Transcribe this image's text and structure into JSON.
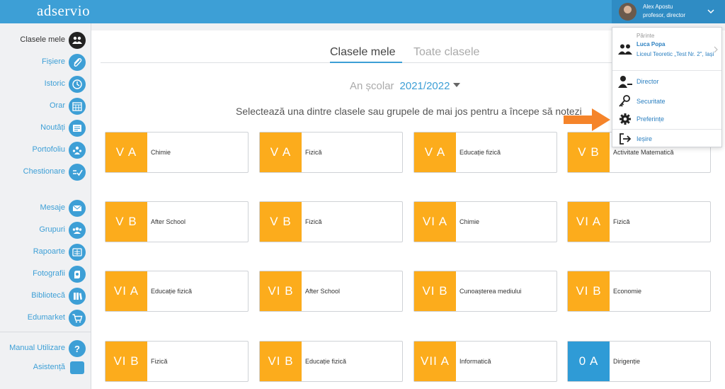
{
  "app": {
    "logo_text": "adservio"
  },
  "user": {
    "name": "Alex Apostu",
    "role": "profesor, director"
  },
  "sidebar": {
    "items": [
      {
        "label": "Clasele mele",
        "icon": "class-icon"
      },
      {
        "label": "Fișiere",
        "icon": "paperclip-icon"
      },
      {
        "label": "Istoric",
        "icon": "history-icon"
      },
      {
        "label": "Orar",
        "icon": "calendar-icon"
      },
      {
        "label": "Noutăți",
        "icon": "news-icon"
      },
      {
        "label": "Portofoliu",
        "icon": "portfolio-icon"
      },
      {
        "label": "Chestionare",
        "icon": "checklist-icon"
      },
      {
        "label": "Mesaje",
        "icon": "envelope-icon"
      },
      {
        "label": "Grupuri",
        "icon": "group-icon"
      },
      {
        "label": "Rapoarte",
        "icon": "report-icon"
      },
      {
        "label": "Fotografii",
        "icon": "photo-icon"
      },
      {
        "label": "Bibliotecă",
        "icon": "library-icon"
      },
      {
        "label": "Edumarket",
        "icon": "cart-icon"
      },
      {
        "label": "Manual Utilizare",
        "icon": "help-icon"
      },
      {
        "label": "Asistență",
        "icon": "chat-icon"
      }
    ]
  },
  "main": {
    "tabs": [
      {
        "label": "Clasele mele"
      },
      {
        "label": "Toate clasele"
      }
    ],
    "school_year": {
      "label": "An școlar",
      "value": "2021/2022"
    },
    "instruction": "Selectează una dintre clasele sau grupele de mai jos pentru a începe să notezi"
  },
  "classes": [
    {
      "class": "V A",
      "subject": "Chimie"
    },
    {
      "class": "V A",
      "subject": "Fizică"
    },
    {
      "class": "V A",
      "subject": "Educație fizică"
    },
    {
      "class": "V B",
      "subject": "Activitate Matematică"
    },
    {
      "class": "V B",
      "subject": "After School"
    },
    {
      "class": "V B",
      "subject": "Fizică"
    },
    {
      "class": "VI A",
      "subject": "Chimie"
    },
    {
      "class": "VI A",
      "subject": "Fizică"
    },
    {
      "class": "VI A",
      "subject": "Educație fizică"
    },
    {
      "class": "VI B",
      "subject": "After School"
    },
    {
      "class": "VI B",
      "subject": "Cunoașterea mediului"
    },
    {
      "class": "VI B",
      "subject": "Economie"
    },
    {
      "class": "VI B",
      "subject": "Fizică"
    },
    {
      "class": "VI B",
      "subject": "Educație fizică"
    },
    {
      "class": "VII A",
      "subject": "Informatică"
    },
    {
      "class": "0 A",
      "subject": "Dirigenție"
    }
  ],
  "dropdown": {
    "parent_label": "Părinte",
    "parent_name": "Luca Popa",
    "parent_school": "Liceul Teoretic „Test Nr. 2\", Iași",
    "items": [
      {
        "label": "Director",
        "icon": "director-icon"
      },
      {
        "label": "Securitate",
        "icon": "key-icon"
      },
      {
        "label": "Preferințe",
        "icon": "gear-icon"
      },
      {
        "label": "Ieșire",
        "icon": "logout-icon"
      }
    ]
  },
  "colors": {
    "header": "#3d9fd6",
    "badge_orange": "#fcac1c",
    "badge_blue": "#2f9bd6",
    "link": "#2a7fc0",
    "arrow": "#f5842a"
  }
}
